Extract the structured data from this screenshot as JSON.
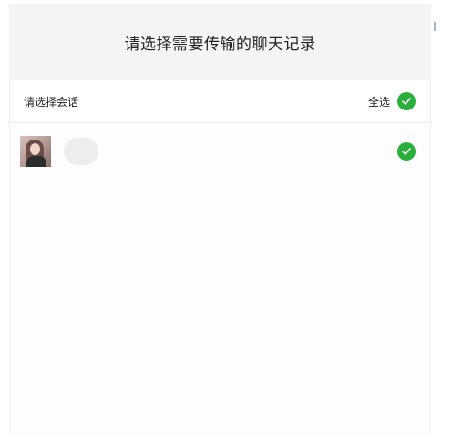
{
  "header": {
    "title": "请选择需要传输的聊天记录"
  },
  "select_bar": {
    "label": "请选择会话",
    "select_all_label": "全选",
    "select_all_checked": true
  },
  "conversations": [
    {
      "name": "",
      "checked": true,
      "avatar": "user-avatar-photo"
    }
  ],
  "icons": {
    "check": "check-icon"
  },
  "colors": {
    "check_green": "#2aae3c",
    "header_bg": "#f4f4f4"
  }
}
